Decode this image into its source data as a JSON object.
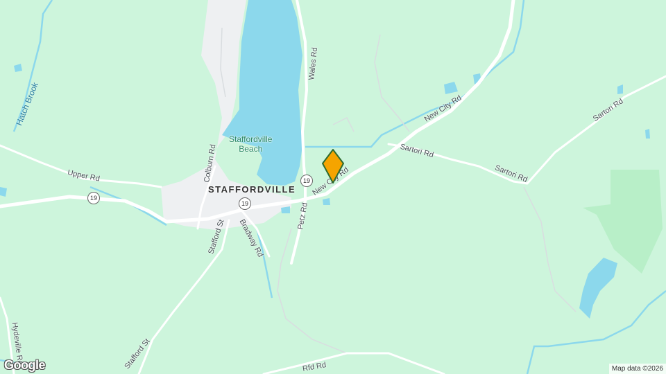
{
  "map": {
    "place": "STAFFORDVILLE",
    "poi": {
      "line1": "Staffordville",
      "line2": "Beach"
    },
    "water": {
      "stream": "Hatch Brook"
    },
    "roads": {
      "wales": "Wales Rd",
      "new_city_upper": "New City Rd",
      "new_city_lower": "New City Rd",
      "sartori_1": "Sartori Rd",
      "sartori_2": "Sartori Rd",
      "sartori_3": "Sartori Rd",
      "upper": "Upper Rd",
      "colburn": "Colburn Rd",
      "stafford_st_1": "Stafford St",
      "stafford_st_2": "Stafford St",
      "bradway": "Bradway Rd",
      "petz": "Petz Rd",
      "hydeville": "Hydeville Rd",
      "rfd": "Rfd Rd"
    },
    "shields": {
      "route_a": "19",
      "route_b": "19",
      "route_c": "19"
    },
    "marker_color": "#f5a400",
    "colors": {
      "land": "#cdf5dc",
      "water": "#8cd8ec",
      "road": "#ffffff",
      "urban": "#eef0f2",
      "park": "#b8efc8"
    }
  },
  "footer": {
    "logo": "Google",
    "attribution": "Map data ©2026"
  }
}
